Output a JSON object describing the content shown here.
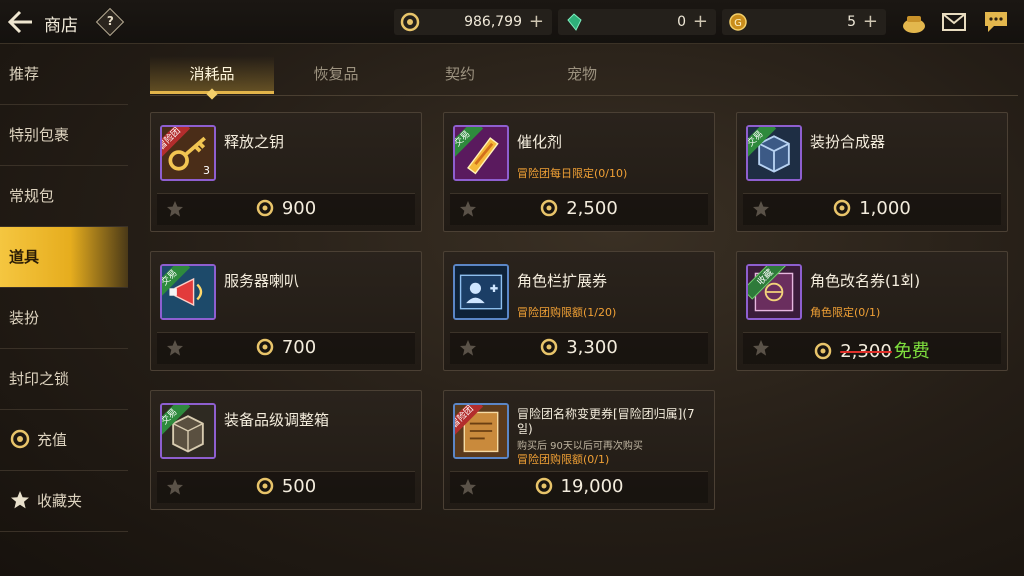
{
  "header": {
    "title": "商店",
    "help": "?",
    "currencies": [
      {
        "icon": "gold-coin-icon",
        "amount": "986,799",
        "plus": "+"
      },
      {
        "icon": "gem-icon",
        "amount": "0",
        "plus": "+"
      },
      {
        "icon": "token-icon",
        "amount": "5",
        "plus": "+"
      }
    ]
  },
  "sidebar": {
    "items": [
      {
        "label": "推荐"
      },
      {
        "label": "特别包裹"
      },
      {
        "label": "常规包"
      },
      {
        "label": "道具"
      },
      {
        "label": "装扮"
      },
      {
        "label": "封印之锁"
      },
      {
        "label": "充值"
      },
      {
        "label": "收藏夹"
      }
    ],
    "active_index": 3
  },
  "tabs": [
    {
      "label": "消耗品"
    },
    {
      "label": "恢复品"
    },
    {
      "label": "契约"
    },
    {
      "label": "宠物"
    }
  ],
  "items": [
    {
      "name": "释放之钥",
      "badge": "冒险团",
      "qty": "3",
      "limit": "",
      "note": "",
      "price": "900"
    },
    {
      "name": "催化剂",
      "badge": "交易",
      "qty": "",
      "limit": "冒险团每日限定(0/10)",
      "note": "",
      "price": "2,500"
    },
    {
      "name": "装扮合成器",
      "badge": "交易",
      "qty": "",
      "limit": "",
      "note": "",
      "price": "1,000"
    },
    {
      "name": "服务器喇叭",
      "badge": "交易",
      "qty": "",
      "limit": "",
      "note": "",
      "price": "700"
    },
    {
      "name": "角色栏扩展券",
      "badge": "",
      "qty": "",
      "limit": "冒险团购限额(1/20)",
      "note": "",
      "price": "3,300"
    },
    {
      "name": "角色改名券(1회)",
      "badge": "收藏",
      "qty": "",
      "limit": "角色限定(0/1)",
      "note": "",
      "price": "2,300",
      "free": "免费"
    },
    {
      "name": "装备品级调整箱",
      "badge": "交易",
      "qty": "",
      "limit": "",
      "note": "",
      "price": "500"
    },
    {
      "name": "冒险团名称变更券[冒险团归属](7일)",
      "badge": "冒险团",
      "qty": "",
      "limit": "冒险团购限额(0/1)",
      "note": "购买后 90天以后可再次购买",
      "price": "19,000"
    }
  ],
  "colors": {
    "accent": "#e6ad1e",
    "limit_text": "#f0a035",
    "free_text": "#7ee03e"
  }
}
